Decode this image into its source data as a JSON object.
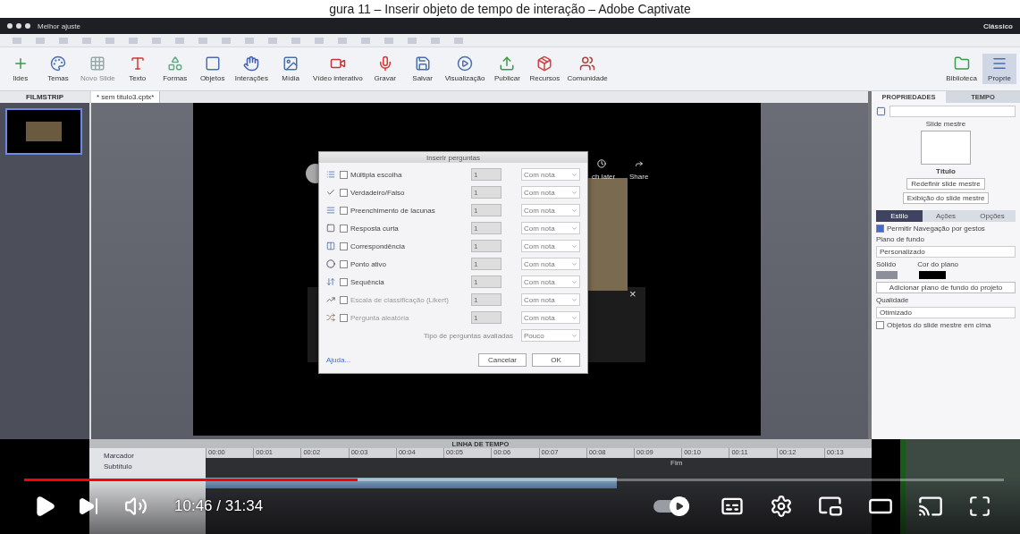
{
  "caption": "gura 11 – Inserir objeto de tempo de interação – Adobe Captivate",
  "app": {
    "top_bar": {
      "zoom": "Melhor ajuste",
      "mode": "Clássico"
    },
    "ribbon": [
      {
        "label": "lides",
        "kind": "plus",
        "disabled": false
      },
      {
        "label": "Temas",
        "kind": "palette",
        "disabled": false
      },
      {
        "label": "Novo Slide",
        "kind": "grid",
        "disabled": true
      },
      {
        "label": "Texto",
        "kind": "text",
        "disabled": false
      },
      {
        "label": "Formas",
        "kind": "shapes",
        "disabled": false
      },
      {
        "label": "Objetos",
        "kind": "frame",
        "disabled": false
      },
      {
        "label": "Interações",
        "kind": "hand",
        "disabled": false
      },
      {
        "label": "Mídia",
        "kind": "image",
        "disabled": false
      },
      {
        "label": "Vídeo interativo",
        "kind": "video",
        "disabled": false
      },
      {
        "label": "Gravar",
        "kind": "mic",
        "disabled": false
      },
      {
        "label": "Salvar",
        "kind": "save",
        "disabled": false
      },
      {
        "label": "Visualização",
        "kind": "play",
        "disabled": false
      },
      {
        "label": "Publicar",
        "kind": "upload",
        "disabled": false
      },
      {
        "label": "Recursos",
        "kind": "box",
        "disabled": false
      },
      {
        "label": "Comunidade",
        "kind": "users",
        "disabled": false
      }
    ],
    "ribbon_right": [
      {
        "label": "Biblioteca",
        "kind": "folder",
        "selected": false
      },
      {
        "label": "Proprie",
        "kind": "menu",
        "selected": true
      }
    ],
    "filmstrip": {
      "title": "FILMSTRIP",
      "slides": [
        {
          "selected": true
        }
      ]
    },
    "document_tab": "* sem título3.cptx*",
    "embed": {
      "watch_later": "ch later",
      "share": "Share",
      "close": "×"
    },
    "dialog": {
      "title": "Inserir perguntas",
      "rows": [
        {
          "kind": "list",
          "label": "Múltipla escolha",
          "count": "1",
          "grading": "Com nota",
          "checked": false,
          "disabled": false
        },
        {
          "kind": "check",
          "label": "Verdadeiro/Falso",
          "count": "1",
          "grading": "Com nota",
          "checked": false,
          "disabled": false
        },
        {
          "kind": "lines",
          "label": "Preenchimento de lacunas",
          "count": "1",
          "grading": "Com nota",
          "checked": false,
          "disabled": false
        },
        {
          "kind": "square",
          "label": "Resposta curta",
          "count": "1",
          "grading": "Com nota",
          "checked": false,
          "disabled": false
        },
        {
          "kind": "columns",
          "label": "Correspondência",
          "count": "1",
          "grading": "Com nota",
          "checked": false,
          "disabled": false
        },
        {
          "kind": "dot",
          "label": "Ponto ativo",
          "count": "1",
          "grading": "Com nota",
          "checked": false,
          "disabled": false
        },
        {
          "kind": "order",
          "label": "Sequência",
          "count": "1",
          "grading": "Com nota",
          "checked": false,
          "disabled": false
        },
        {
          "kind": "scale",
          "label": "Escala de classificação (Likert)",
          "count": "1",
          "grading": "Com nota",
          "checked": false,
          "disabled": true
        },
        {
          "kind": "random",
          "label": "Pergunta aleatória",
          "count": "1",
          "grading": "Com nota",
          "checked": false,
          "disabled": true
        }
      ],
      "graded_label": "Tipo de perguntas avaliadas",
      "graded_value": "Pouco",
      "help": "Ajuda...",
      "cancel": "Cancelar",
      "ok": "OK"
    },
    "properties": {
      "tabs": [
        {
          "label": "PROPRIEDADES",
          "selected": true
        },
        {
          "label": "TEMPO",
          "selected": false
        }
      ],
      "master_label": "Slide mestre",
      "master_title": "Título",
      "reset": "Redefinir slide mestre",
      "show_master": "Exibição do slide mestre",
      "subtabs": [
        {
          "label": "Estilo",
          "selected": true
        },
        {
          "label": "Ações",
          "selected": false
        },
        {
          "label": "Opções",
          "selected": false
        }
      ],
      "gesture": {
        "label": "Permitir Navegação por gestos",
        "checked": true
      },
      "background_label": "Plano de fundo",
      "background_value": "Personalizado",
      "solid_label": "Sólido",
      "color_label": "Cor do plano",
      "add_background": "Adicionar plano de fundo do projeto",
      "quality_label": "Qualidade",
      "quality_value": "Otimizado",
      "objects_on_top": {
        "label": "Objetos do slide mestre em cima",
        "checked": false
      }
    },
    "timeline": {
      "title": "LINHA DE TEMPO",
      "ticks": [
        "00:00",
        "00:01",
        "00:02",
        "00:03",
        "00:04",
        "00:05",
        "00:06",
        "00:07",
        "00:08",
        "00:09",
        "00:10",
        "00:11",
        "00:12",
        "00:13"
      ],
      "tracks": [
        {
          "label": "Marcador",
          "selected": false
        },
        {
          "label": "Subtítulo",
          "selected": false
        }
      ],
      "end_label": "Fim"
    }
  },
  "player": {
    "progress": {
      "level": 0.34
    },
    "time": "10:46 / 31:34",
    "autoplay": {
      "on": true
    }
  }
}
